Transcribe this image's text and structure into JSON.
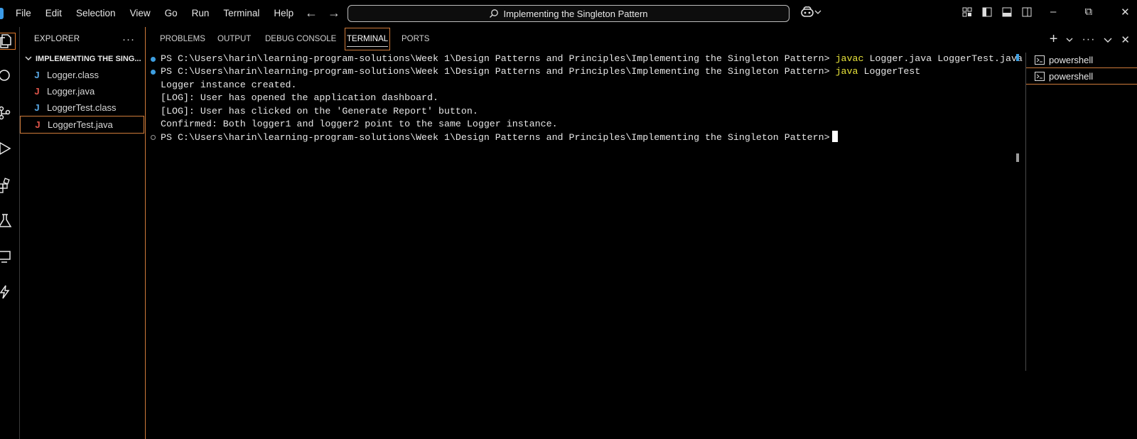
{
  "menu": [
    "File",
    "Edit",
    "Selection",
    "View",
    "Go",
    "Run",
    "Terminal",
    "Help"
  ],
  "search": {
    "text": "Implementing the Singleton Pattern"
  },
  "explorer": {
    "title": "EXPLORER",
    "more": "···",
    "folder": "IMPLEMENTING THE SING...",
    "files": [
      {
        "name": "Logger.class",
        "icon": "J",
        "icon_color": "#5aa9e6"
      },
      {
        "name": "Logger.java",
        "icon": "J",
        "icon_color": "#e0554a"
      },
      {
        "name": "LoggerTest.class",
        "icon": "J",
        "icon_color": "#5aa9e6"
      },
      {
        "name": "LoggerTest.java",
        "icon": "J",
        "icon_color": "#e0554a"
      }
    ]
  },
  "panel": {
    "tabs": [
      "PROBLEMS",
      "OUTPUT",
      "DEBUG CONSOLE",
      "TERMINAL",
      "PORTS"
    ],
    "active_tab": "TERMINAL"
  },
  "terminal": {
    "prompt": "PS C:\\Users\\harin\\learning-program-solutions\\Week 1\\Design Patterns and Principles\\Implementing the Singleton Pattern>",
    "cmd1": {
      "exe": "javac",
      "args": "Logger.java LoggerTest.java"
    },
    "cmd2": {
      "exe": "java",
      "args": "LoggerTest"
    },
    "output": [
      "Logger instance created.",
      "[LOG]: User has opened the application dashboard.",
      "[LOG]: User has clicked on the 'Generate Report' button.",
      "Confirmed: Both logger1 and logger2 point to the same Logger instance."
    ]
  },
  "terminal_tabs": [
    "powershell",
    "powershell"
  ],
  "colors": {
    "accent": "#cf7b3a",
    "focus_blue": "#3d9ee0",
    "command_yellow": "#e8e33a"
  }
}
